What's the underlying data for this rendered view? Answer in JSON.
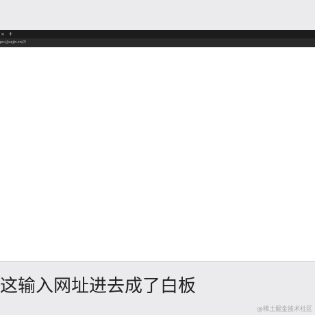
{
  "browser": {
    "tab_close_glyph": "×",
    "new_tab_glyph": "+",
    "address_url": "ps://juejin.cn/?/"
  },
  "caption": {
    "text": "这输入网址进去成了白板"
  },
  "watermark": {
    "text": "@稀土掘金技术社区"
  },
  "colors": {
    "background": "#ebebed",
    "browser_chrome": "#1c1c1c",
    "page_blank": "#ffffff"
  }
}
